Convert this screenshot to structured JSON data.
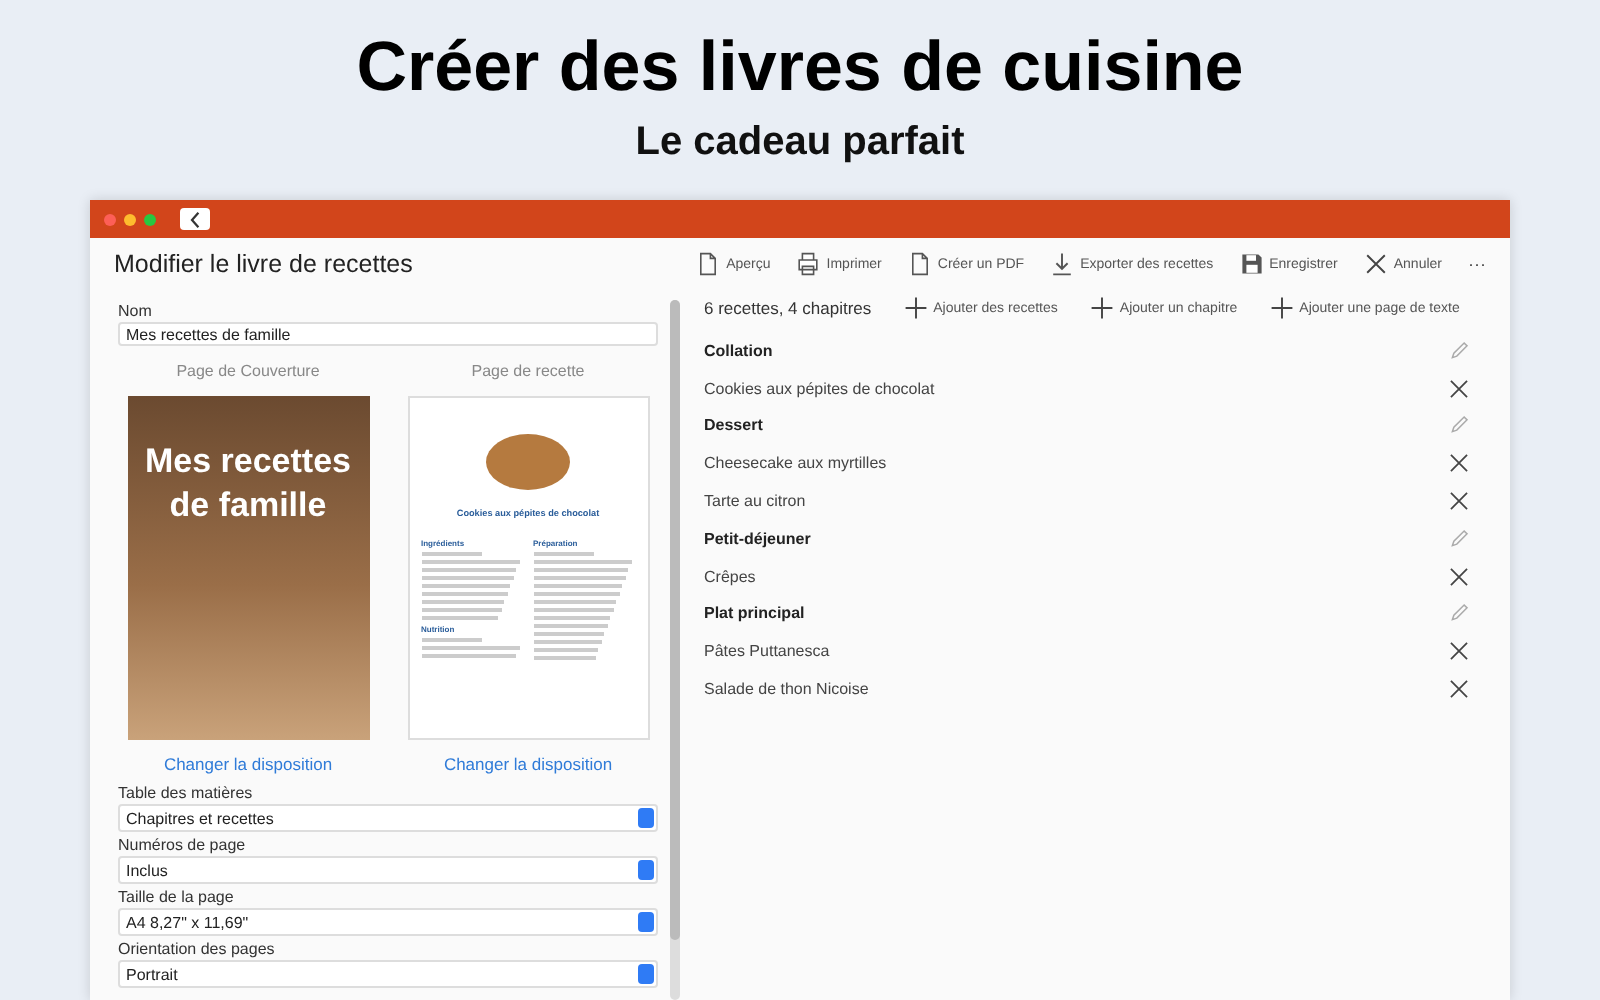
{
  "headline": "Créer des livres de cuisine",
  "subheadline": "Le cadeau parfait",
  "window": {
    "title": "Modifier le livre de recettes"
  },
  "toolbar": [
    {
      "kind": "page",
      "label": "Aperçu"
    },
    {
      "kind": "print",
      "label": "Imprimer"
    },
    {
      "kind": "page",
      "label": "Créer un PDF"
    },
    {
      "kind": "download",
      "label": "Exporter des recettes"
    },
    {
      "kind": "save",
      "label": "Enregistrer"
    },
    {
      "kind": "close",
      "label": "Annuler"
    },
    {
      "kind": "more",
      "label": "···"
    }
  ],
  "left": {
    "name_label": "Nom",
    "name_value": "Mes recettes de famille",
    "cover": {
      "caption": "Page de Couverture",
      "title": "Mes recettes de famille",
      "link": "Changer la disposition"
    },
    "recipe_page": {
      "caption": "Page de recette",
      "title": "Cookies aux pépites de chocolat",
      "sections": [
        "Ingrédients",
        "Préparation",
        "Nutrition"
      ],
      "link": "Changer la disposition"
    },
    "selects": [
      {
        "label": "Table des matières",
        "value": "Chapitres et recettes"
      },
      {
        "label": "Numéros de page",
        "value": "Inclus"
      },
      {
        "label": "Taille de la page",
        "value": "A4 8,27\" x 11,69\""
      },
      {
        "label": "Orientation des pages",
        "value": "Portrait"
      }
    ]
  },
  "summary": "6 recettes, 4 chapitres",
  "add_actions": [
    "Ajouter des recettes",
    "Ajouter un chapitre",
    "Ajouter une page de texte"
  ],
  "items": [
    {
      "kind": "chapter",
      "label": "Collation"
    },
    {
      "kind": "recipe",
      "label": "Cookies aux pépites de chocolat"
    },
    {
      "kind": "chapter",
      "label": "Dessert"
    },
    {
      "kind": "recipe",
      "label": "Cheesecake aux myrtilles"
    },
    {
      "kind": "recipe",
      "label": "Tarte au citron"
    },
    {
      "kind": "chapter",
      "label": "Petit-déjeuner"
    },
    {
      "kind": "recipe",
      "label": "Crêpes"
    },
    {
      "kind": "chapter",
      "label": "Plat principal"
    },
    {
      "kind": "recipe",
      "label": "Pâtes Puttanesca"
    },
    {
      "kind": "recipe",
      "label": "Salade de thon Nicoise"
    }
  ]
}
